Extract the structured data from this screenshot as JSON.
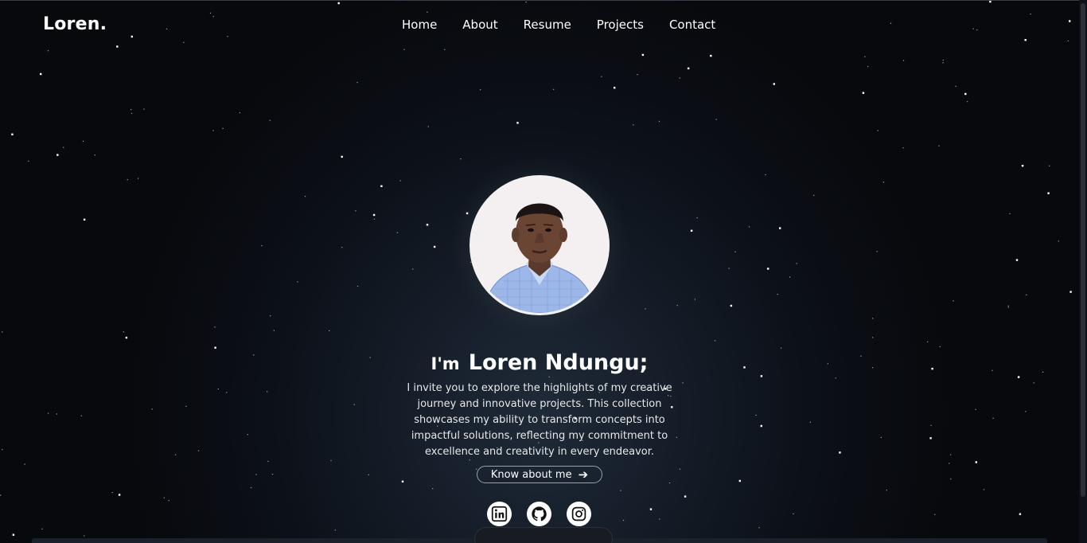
{
  "brand": {
    "logo": "Loren."
  },
  "nav": {
    "items": [
      {
        "label": "Home"
      },
      {
        "label": "About"
      },
      {
        "label": "Resume"
      },
      {
        "label": "Projects"
      },
      {
        "label": "Contact"
      }
    ]
  },
  "hero": {
    "greeting": "I'm",
    "name": "Loren Ndungu;",
    "intro": "I invite you to explore the highlights of my creative journey and innovative projects. This collection showcases my ability to transform concepts into impactful solutions, reflecting my commitment to excellence and creativity in every endeavor.",
    "cta_label": "Know about me"
  },
  "socials": [
    {
      "icon": "linkedin-icon"
    },
    {
      "icon": "github-icon"
    },
    {
      "icon": "instagram-icon"
    }
  ],
  "colors": {
    "background": "#08090d",
    "glow": "#1f2a38",
    "text": "#ffffff",
    "button_border": "#9aa0a8"
  }
}
